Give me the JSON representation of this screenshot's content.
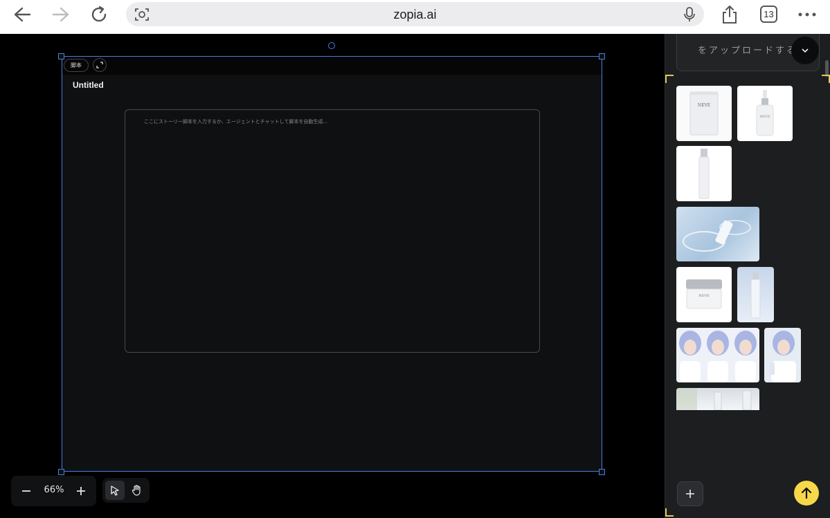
{
  "browser": {
    "url": "zopia.ai",
    "tab_count": "13"
  },
  "canvas": {
    "frame_badge": "脚本",
    "frame_title": "Untitled",
    "script_placeholder": "ここにストーリー脚本を入力するか、エージェントとチャットして脚本を自動生成..."
  },
  "toolbar": {
    "zoom_value": "66%"
  },
  "side_panel": {
    "upload_text": "をアップロードする",
    "thumbnails": [
      {
        "name": "neve-sachet-thumbnail",
        "label": "NEVE"
      },
      {
        "name": "neve-dropper-bottle-thumbnail",
        "label": "NEVE"
      },
      {
        "name": "neve-tall-bottle-thumbnail",
        "label": ""
      },
      {
        "name": "bottle-in-water-thumbnail",
        "label": ""
      },
      {
        "name": "neve-cream-jar-thumbnail",
        "label": "NEVE"
      },
      {
        "name": "bottle-blue-backdrop-thumbnail",
        "label": ""
      },
      {
        "name": "character-three-views-thumbnail",
        "label": ""
      },
      {
        "name": "character-holding-bottle-thumbnail",
        "label": ""
      },
      {
        "name": "bottles-on-shelf-thumbnail",
        "label": ""
      }
    ]
  },
  "colors": {
    "selection": "#4a7fe0",
    "accent": "#f7d84a",
    "canvas_bg": "#000000",
    "frame_bg": "#0f1012",
    "panel_bg": "#1c1e20"
  }
}
